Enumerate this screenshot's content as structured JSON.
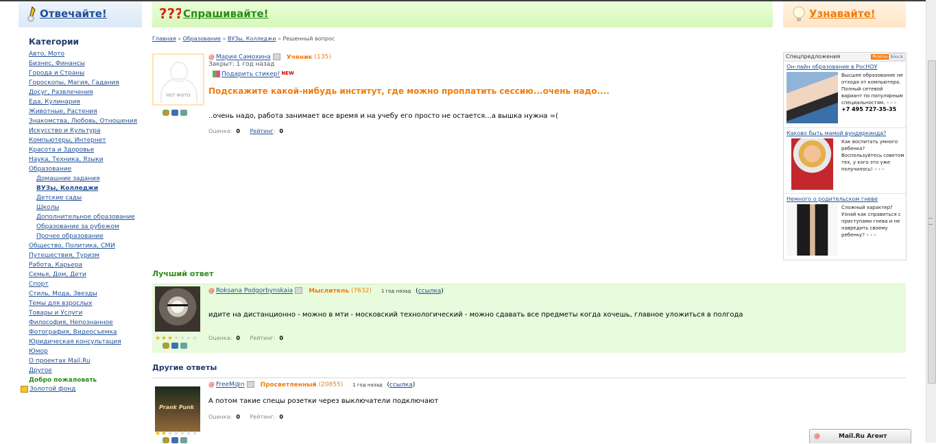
{
  "header": {
    "answer": "Отвечайте!",
    "ask": "Спрашивайте!",
    "learn": "Узнавайте!"
  },
  "sidebar": {
    "title": "Категории",
    "items": [
      {
        "label": "Авто, Мото",
        "level": 0
      },
      {
        "label": "Бизнес, Финансы",
        "level": 0
      },
      {
        "label": "Города и Страны",
        "level": 0
      },
      {
        "label": "Гороскопы, Магия, Гадания",
        "level": 0
      },
      {
        "label": "Досуг, Развлечения",
        "level": 0
      },
      {
        "label": "Еда, Кулинария",
        "level": 0
      },
      {
        "label": "Животные, Растения",
        "level": 0
      },
      {
        "label": "Знакомства, Любовь, Отношения",
        "level": 0
      },
      {
        "label": "Искусство и Культура",
        "level": 0
      },
      {
        "label": "Компьютеры, Интернет",
        "level": 0
      },
      {
        "label": "Красота и Здоровье",
        "level": 0
      },
      {
        "label": "Наука, Техника, Языки",
        "level": 0
      },
      {
        "label": "Образование",
        "level": 0
      },
      {
        "label": "Домашние задания",
        "level": 1
      },
      {
        "label": "ВУЗы, Колледжи",
        "level": 1,
        "active": true
      },
      {
        "label": "Детские сады",
        "level": 1
      },
      {
        "label": "Школы",
        "level": 1
      },
      {
        "label": "Дополнительное образование",
        "level": 1
      },
      {
        "label": "Образование за рубежом",
        "level": 1
      },
      {
        "label": "Прочее образование",
        "level": 1
      },
      {
        "label": "Общество, Политика, СМИ",
        "level": 0
      },
      {
        "label": "Путешествия, Туризм",
        "level": 0
      },
      {
        "label": "Работа, Карьера",
        "level": 0
      },
      {
        "label": "Семья, Дом, Дети",
        "level": 0
      },
      {
        "label": "Спорт",
        "level": 0
      },
      {
        "label": "Стиль, Мода, Звезды",
        "level": 0
      },
      {
        "label": "Темы для взрослых",
        "level": 0
      },
      {
        "label": "Товары и Услуги",
        "level": 0
      },
      {
        "label": "Философия, Непознанное",
        "level": 0
      },
      {
        "label": "Фотография, Видеосъемка",
        "level": 0
      },
      {
        "label": "Юридическая консультация",
        "level": 0
      },
      {
        "label": "Юмор",
        "level": 0
      },
      {
        "label": "О проектах Mail.Ru",
        "level": 0
      },
      {
        "label": "Другое",
        "level": 0
      }
    ],
    "welcome": "Добро пожаловать",
    "gold_fund": "Золотой фонд"
  },
  "breadcrumb": {
    "home": "Главная",
    "education": "Образование",
    "universities": "ВУЗы, Колледжи",
    "current": "Решенный вопрос",
    "sep": "»"
  },
  "question": {
    "no_photo": "НЕТ ФОТО",
    "author": "Мария Самохина",
    "rank": "Ученик",
    "points": "(135)",
    "closed": "Закрыт: 1 год назад",
    "gift": "Подарить стикер!",
    "gift_new": "NEW",
    "title": "Подскажите какой-нибудь институт, где можно проплатить сессию...очень надо....",
    "text": "..очень надо, работа занимает все время и на учебу его просто не остается...а вышка нужна =(",
    "score_label": "Оценка:",
    "score": "0",
    "rating_label": "Рейтинг",
    "rating": "0"
  },
  "best_answer": {
    "section_title": "Лучший ответ",
    "author": "Roksana Podgorbynskaia",
    "rank": "Мыслитель",
    "points": "(7632)",
    "ago": "1 год назад",
    "link": "ссылка",
    "text": "идите на дистанционно - можно в мти - московский технологический - можно сдавать все предметы когда хочешь, главное уложиться в полгода",
    "score_label": "Оценка:",
    "score": "0",
    "rating_label": "Рейтинг:",
    "rating": "0",
    "stars": 3
  },
  "other_answers": {
    "section_title": "Другие ответы",
    "items": [
      {
        "author": "FreeM@n",
        "rank": "Просветленный",
        "points": "(20855)",
        "ago": "1 год назад",
        "link": "ссылка",
        "text": "А потом такие спецы розетки через выключатели подключают",
        "avatar_text": "Prank Punk",
        "score_label": "Оценка:",
        "score": "0",
        "rating_label": "Рейтинг:",
        "rating": "0",
        "stars": 2
      }
    ]
  },
  "promo": {
    "title": "Спецпредложения",
    "badge_a": "Promo",
    "badge_b": "block",
    "items": [
      {
        "title": "Он-лайн образование в РосНОУ",
        "text": "Высшее образование не отходя от компьютера. Полный сетевой вариант по популярным специальностям.",
        "more": "»»»",
        "phone": "+7 495 727-35-35"
      },
      {
        "title": "Каково быть мамой вундеркинда?",
        "text": "Как воспитать умного ребенка? Воспользуйтесь советом тех, у кого это уже получилось!",
        "more": "»»»"
      },
      {
        "title": "Немного о родительском гневе",
        "text": "Сложный характер? Узнай как справиться с приступами гнева и не навредить своему ребенку?",
        "more": "»»»"
      }
    ]
  },
  "agent": {
    "label": "Mail.Ru Агент"
  },
  "colors": {
    "orange": "#f07d0d",
    "green": "#2b8b17",
    "link": "#1f4f96",
    "best_bg": "#e8fbdc"
  }
}
